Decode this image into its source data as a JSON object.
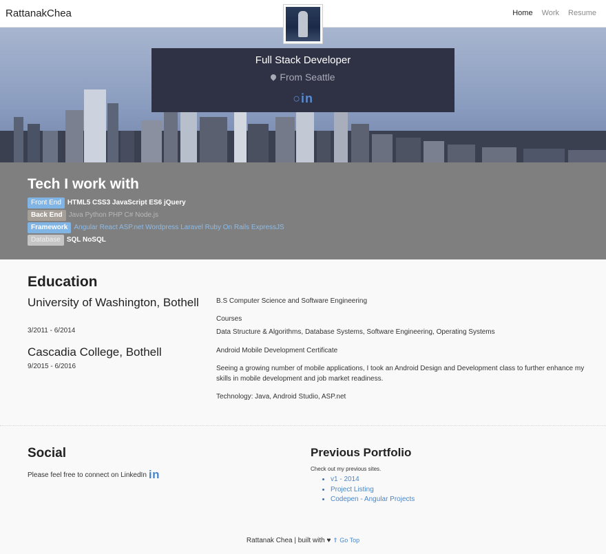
{
  "navbar": {
    "brand": "RattanakChea",
    "links": [
      {
        "label": "Home",
        "active": true
      },
      {
        "label": "Work",
        "active": false
      },
      {
        "label": "Resume",
        "active": false
      }
    ]
  },
  "hero": {
    "title": "Full Stack Developer",
    "location": "From Seattle",
    "social_icons": [
      "github-icon",
      "linkedin-icon"
    ],
    "social_text": "in"
  },
  "tech": {
    "heading": "Tech I work with",
    "rows": [
      {
        "label": "Front End",
        "items": "HTML5 CSS3 JavaScript ES6 jQuery"
      },
      {
        "label": "Back End",
        "items": "Java Python PHP C# Node.js"
      },
      {
        "label": "Framework",
        "items": "Angular React ASP.net Wordpress Laravel Ruby On Rails ExpressJS"
      },
      {
        "label": "Database",
        "items": "SQL NoSQL"
      }
    ]
  },
  "education": {
    "heading": "Education",
    "schools": [
      {
        "name": "University of Washington, Bothell",
        "dates": "3/2011 - 6/2014"
      },
      {
        "name": "Cascadia College, Bothell",
        "dates": "9/2015 - 6/2016"
      }
    ],
    "details": {
      "degree": "B.S Computer Science and Software Engineering",
      "courses_label": "Courses",
      "courses": "Data Structure & Algorithms, Database Systems, Software Engineering, Operating Systems",
      "certificate": "Android Mobile Development Certificate",
      "description": "Seeing a growing number of mobile applications, I took an Android Design and Development class to further enhance my skills in mobile development and job market readiness.",
      "technology": "Technology: Java, Android Studio, ASP.net"
    }
  },
  "social": {
    "heading": "Social",
    "text": "Please feel free to connect on LinkedIn",
    "icon_text": "in"
  },
  "portfolio": {
    "heading": "Previous Portfolio",
    "intro": "Check out my previous sites.",
    "links": [
      "v1 - 2014",
      "Project Listing",
      "Codepen - Angular Projects"
    ]
  },
  "footer": {
    "text": "Rattanak Chea | built with",
    "heart": "♥",
    "go_top": "⇑ Go Top"
  },
  "colors": {
    "hero_card": "#2f3245",
    "tech_bg": "#7f7f7f",
    "link": "#4a86c8",
    "tag_blue": "#7fb4e4"
  }
}
